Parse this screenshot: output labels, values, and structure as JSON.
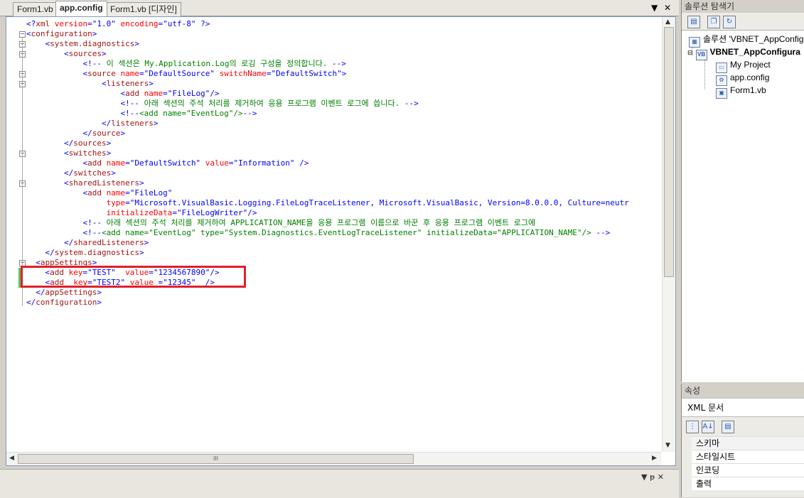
{
  "editor": {
    "tabs": [
      {
        "label": "Form1.vb"
      },
      {
        "label": "app.config"
      },
      {
        "label": "Form1.vb [디자인]"
      }
    ],
    "tab_dropdown": "▼",
    "tab_close": "✕",
    "hscroll_grip": "III"
  },
  "code_lines": [
    [
      {
        "c": "b",
        "t": "<?"
      },
      {
        "c": "t",
        "t": "xml"
      },
      {
        "c": "a",
        "t": " version"
      },
      {
        "c": "b",
        "t": "="
      },
      {
        "c": "v",
        "t": "\"1.0\""
      },
      {
        "c": "a",
        "t": " encoding"
      },
      {
        "c": "b",
        "t": "="
      },
      {
        "c": "v",
        "t": "\"utf-8\""
      },
      {
        "c": "b",
        "t": " ?>"
      }
    ],
    [
      {
        "c": "b",
        "t": "<"
      },
      {
        "c": "t",
        "t": "configuration"
      },
      {
        "c": "b",
        "t": ">"
      }
    ],
    [
      {
        "c": "x",
        "t": "    "
      },
      {
        "c": "b",
        "t": "<"
      },
      {
        "c": "t",
        "t": "system.diagnostics"
      },
      {
        "c": "b",
        "t": ">"
      }
    ],
    [
      {
        "c": "x",
        "t": "        "
      },
      {
        "c": "b",
        "t": "<"
      },
      {
        "c": "t",
        "t": "sources"
      },
      {
        "c": "b",
        "t": ">"
      }
    ],
    [
      {
        "c": "x",
        "t": "            "
      },
      {
        "c": "b",
        "t": "<!--"
      },
      {
        "c": "c",
        "t": " 이 섹션은 My.Application.Log의 로깅 구성을 정의합니다. "
      },
      {
        "c": "b",
        "t": "-->"
      }
    ],
    [
      {
        "c": "x",
        "t": "            "
      },
      {
        "c": "b",
        "t": "<"
      },
      {
        "c": "t",
        "t": "source"
      },
      {
        "c": "a",
        "t": " name"
      },
      {
        "c": "b",
        "t": "="
      },
      {
        "c": "v",
        "t": "\"DefaultSource\""
      },
      {
        "c": "a",
        "t": " switchName"
      },
      {
        "c": "b",
        "t": "="
      },
      {
        "c": "v",
        "t": "\"DefaultSwitch\""
      },
      {
        "c": "b",
        "t": ">"
      }
    ],
    [
      {
        "c": "x",
        "t": "                "
      },
      {
        "c": "b",
        "t": "<"
      },
      {
        "c": "t",
        "t": "listeners"
      },
      {
        "c": "b",
        "t": ">"
      }
    ],
    [
      {
        "c": "x",
        "t": "                    "
      },
      {
        "c": "b",
        "t": "<"
      },
      {
        "c": "t",
        "t": "add"
      },
      {
        "c": "a",
        "t": " name"
      },
      {
        "c": "b",
        "t": "="
      },
      {
        "c": "v",
        "t": "\"FileLog\""
      },
      {
        "c": "b",
        "t": "/>"
      }
    ],
    [
      {
        "c": "x",
        "t": "                    "
      },
      {
        "c": "b",
        "t": "<!--"
      },
      {
        "c": "c",
        "t": " 아래 섹션의 주석 처리를 제거하여 응용 프로그램 이벤트 로그에 씁니다. "
      },
      {
        "c": "b",
        "t": "-->"
      }
    ],
    [
      {
        "c": "x",
        "t": "                    "
      },
      {
        "c": "b",
        "t": "<!--"
      },
      {
        "c": "c",
        "t": "<add name=\"EventLog\"/>"
      },
      {
        "c": "b",
        "t": "-->"
      }
    ],
    [
      {
        "c": "x",
        "t": "                "
      },
      {
        "c": "b",
        "t": "</"
      },
      {
        "c": "t",
        "t": "listeners"
      },
      {
        "c": "b",
        "t": ">"
      }
    ],
    [
      {
        "c": "x",
        "t": "            "
      },
      {
        "c": "b",
        "t": "</"
      },
      {
        "c": "t",
        "t": "source"
      },
      {
        "c": "b",
        "t": ">"
      }
    ],
    [
      {
        "c": "x",
        "t": "        "
      },
      {
        "c": "b",
        "t": "</"
      },
      {
        "c": "t",
        "t": "sources"
      },
      {
        "c": "b",
        "t": ">"
      }
    ],
    [
      {
        "c": "x",
        "t": "        "
      },
      {
        "c": "b",
        "t": "<"
      },
      {
        "c": "t",
        "t": "switches"
      },
      {
        "c": "b",
        "t": ">"
      }
    ],
    [
      {
        "c": "x",
        "t": "            "
      },
      {
        "c": "b",
        "t": "<"
      },
      {
        "c": "t",
        "t": "add"
      },
      {
        "c": "a",
        "t": " name"
      },
      {
        "c": "b",
        "t": "="
      },
      {
        "c": "v",
        "t": "\"DefaultSwitch\""
      },
      {
        "c": "a",
        "t": " value"
      },
      {
        "c": "b",
        "t": "="
      },
      {
        "c": "v",
        "t": "\"Information\""
      },
      {
        "c": "b",
        "t": " />"
      }
    ],
    [
      {
        "c": "x",
        "t": "        "
      },
      {
        "c": "b",
        "t": "</"
      },
      {
        "c": "t",
        "t": "switches"
      },
      {
        "c": "b",
        "t": ">"
      }
    ],
    [
      {
        "c": "x",
        "t": "        "
      },
      {
        "c": "b",
        "t": "<"
      },
      {
        "c": "t",
        "t": "sharedListeners"
      },
      {
        "c": "b",
        "t": ">"
      }
    ],
    [
      {
        "c": "x",
        "t": "            "
      },
      {
        "c": "b",
        "t": "<"
      },
      {
        "c": "t",
        "t": "add"
      },
      {
        "c": "a",
        "t": " name"
      },
      {
        "c": "b",
        "t": "="
      },
      {
        "c": "v",
        "t": "\"FileLog\""
      }
    ],
    [
      {
        "c": "x",
        "t": "                 "
      },
      {
        "c": "a",
        "t": "type"
      },
      {
        "c": "b",
        "t": "="
      },
      {
        "c": "v",
        "t": "\"Microsoft.VisualBasic.Logging.FileLogTraceListener, Microsoft.VisualBasic, Version=8.0.0.0, Culture=neutr"
      }
    ],
    [
      {
        "c": "x",
        "t": "                 "
      },
      {
        "c": "a",
        "t": "initializeData"
      },
      {
        "c": "b",
        "t": "="
      },
      {
        "c": "v",
        "t": "\"FileLogWriter\""
      },
      {
        "c": "b",
        "t": "/>"
      }
    ],
    [
      {
        "c": "x",
        "t": "            "
      },
      {
        "c": "b",
        "t": "<!--"
      },
      {
        "c": "c",
        "t": " 아래 섹션의 주석 처리를 제거하여 APPLICATION_NAME을 응용 프로그램 이름으로 바꾼 후 응용 프로그램 이벤트 로그에"
      }
    ],
    [
      {
        "c": "x",
        "t": "            "
      },
      {
        "c": "b",
        "t": "<!--"
      },
      {
        "c": "c",
        "t": "<add name=\"EventLog\" type=\"System.Diagnostics.EventLogTraceListener\" initializeData=\"APPLICATION_NAME\"/>"
      },
      {
        "c": "b",
        "t": " -->"
      }
    ],
    [
      {
        "c": "x",
        "t": "        "
      },
      {
        "c": "b",
        "t": "</"
      },
      {
        "c": "t",
        "t": "sharedListeners"
      },
      {
        "c": "b",
        "t": ">"
      }
    ],
    [
      {
        "c": "x",
        "t": "    "
      },
      {
        "c": "b",
        "t": "</"
      },
      {
        "c": "t",
        "t": "system.diagnostics"
      },
      {
        "c": "b",
        "t": ">"
      }
    ],
    [
      {
        "c": "x",
        "t": "  "
      },
      {
        "c": "b",
        "t": "<"
      },
      {
        "c": "t",
        "t": "appSettings"
      },
      {
        "c": "b",
        "t": ">"
      }
    ],
    [
      {
        "c": "x",
        "t": "    "
      },
      {
        "c": "b",
        "t": "<"
      },
      {
        "c": "t",
        "t": "add"
      },
      {
        "c": "a",
        "t": " key"
      },
      {
        "c": "b",
        "t": "="
      },
      {
        "c": "v",
        "t": "\"TEST\""
      },
      {
        "c": "a",
        "t": "  value"
      },
      {
        "c": "b",
        "t": "="
      },
      {
        "c": "v",
        "t": "\"1234567890\""
      },
      {
        "c": "b",
        "t": "/>"
      }
    ],
    [
      {
        "c": "x",
        "t": "    "
      },
      {
        "c": "b",
        "t": "<"
      },
      {
        "c": "t",
        "t": "add"
      },
      {
        "c": "a",
        "t": "  key"
      },
      {
        "c": "b",
        "t": "="
      },
      {
        "c": "v",
        "t": "\"TEST2\""
      },
      {
        "c": "a",
        "t": " value "
      },
      {
        "c": "b",
        "t": "="
      },
      {
        "c": "v",
        "t": "\"12345\""
      },
      {
        "c": "b",
        "t": "  />"
      }
    ],
    [
      {
        "c": "x",
        "t": "  "
      },
      {
        "c": "b",
        "t": "</"
      },
      {
        "c": "t",
        "t": "appSettings"
      },
      {
        "c": "b",
        "t": ">"
      }
    ],
    [
      {
        "c": "b",
        "t": "</"
      },
      {
        "c": "t",
        "t": "configuration"
      },
      {
        "c": "b",
        "t": ">"
      }
    ]
  ],
  "colors": {
    "tag": "#a31515",
    "bracket": "#0000ff",
    "attr": "#ff0000",
    "value": "#0000ff",
    "comment": "#008000",
    "highlight": "#e0202a"
  },
  "solution_explorer": {
    "title": "솔루션 탐색기",
    "items": [
      {
        "label": "솔루션 'VBNET_AppConfig",
        "icon": "solution-icon"
      },
      {
        "label": "VBNET_AppConfigura",
        "icon": "vb-project-icon"
      },
      {
        "label": "My Project",
        "icon": "my-project-icon"
      },
      {
        "label": "app.config",
        "icon": "config-file-icon"
      },
      {
        "label": "Form1.vb",
        "icon": "form-icon"
      }
    ]
  },
  "properties": {
    "title": "속성",
    "object": "XML 문서",
    "rows": [
      "스키마",
      "스타일시트",
      "인코딩",
      "출력"
    ]
  },
  "bottom": {
    "pin": "▼ ᵽ ✕"
  }
}
